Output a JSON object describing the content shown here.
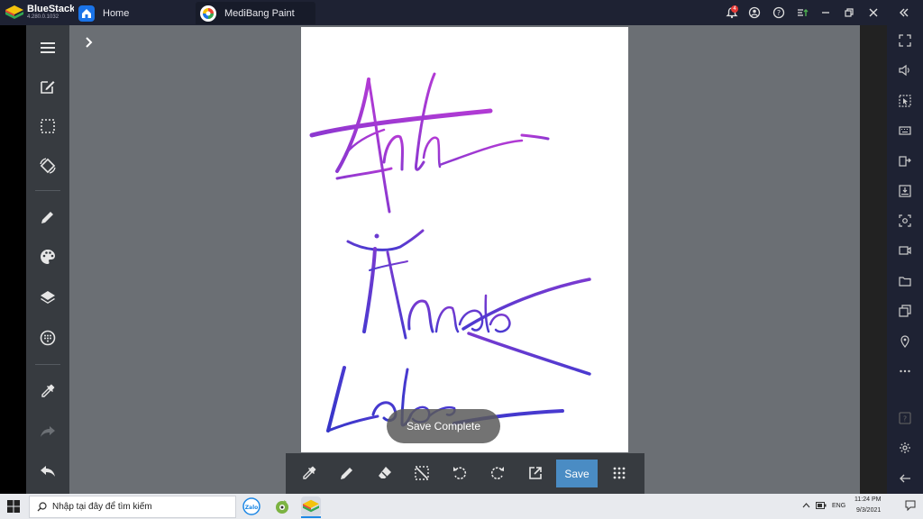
{
  "bluestacks": {
    "name": "BlueStacks",
    "version": "4.280.0.1032"
  },
  "tabs": [
    {
      "label": "Home",
      "icon": "home-icon"
    },
    {
      "label": "MediBang Paint",
      "icon": "medibang-icon"
    }
  ],
  "notification_count": "4",
  "canvas": {
    "handwriting": [
      "Anh",
      "Mando",
      "Lab"
    ]
  },
  "toast": "Save Complete",
  "bottom_toolbar": {
    "save_label": "Save"
  },
  "taskbar": {
    "search_placeholder": "Nhập tại đây để tìm kiếm",
    "apps": [
      "zalo-icon",
      "coccoc-icon",
      "bluestacks-icon"
    ],
    "language": "ENG",
    "time": "11:24 PM",
    "date": "9/3/2021"
  },
  "colors": {
    "accent": "#4a8cc4",
    "stroke_purple": "#a038d0",
    "stroke_blue": "#3a3ad0"
  }
}
